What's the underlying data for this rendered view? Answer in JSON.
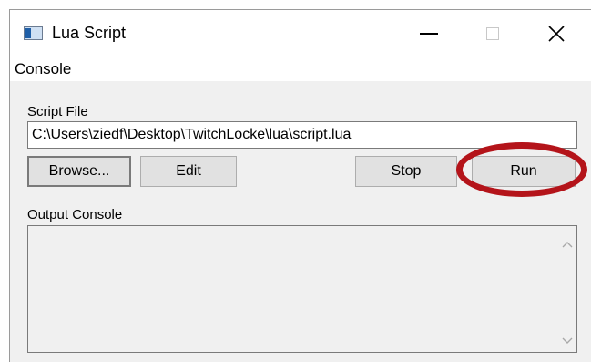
{
  "window": {
    "title": "Lua Script",
    "icon": "app-window-icon"
  },
  "menu": {
    "items": [
      {
        "label": "Console"
      }
    ]
  },
  "script_file": {
    "label": "Script File",
    "path": "C:\\Users\\ziedf\\Desktop\\TwitchLocke\\lua\\script.lua"
  },
  "buttons": {
    "browse": "Browse...",
    "edit": "Edit",
    "stop": "Stop",
    "run": "Run"
  },
  "output": {
    "label": "Output Console",
    "text": ""
  },
  "colors": {
    "highlight_ring": "#b4141a",
    "window_bg": "#f0f0f0",
    "button_bg": "#e1e1e1"
  }
}
